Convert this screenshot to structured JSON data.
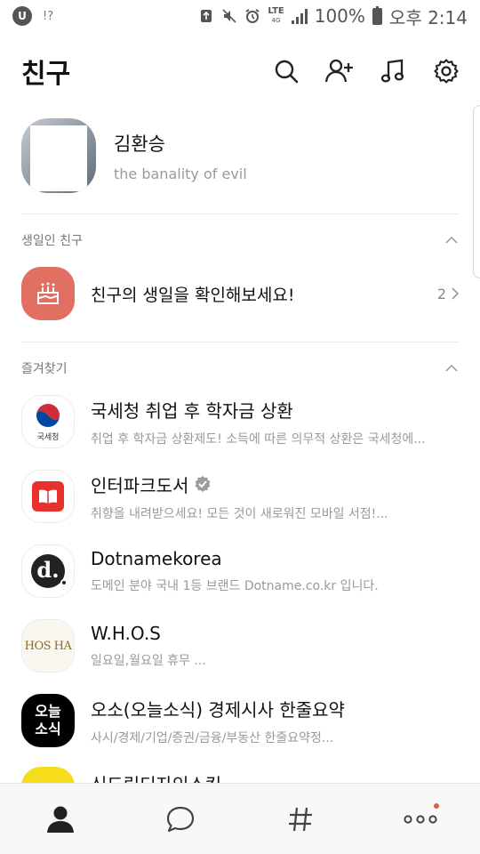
{
  "status_bar": {
    "app_badge": "U",
    "signal_text": "!?",
    "network": "LTE",
    "network_sub": "4G",
    "battery": "100%",
    "time": "오후 2:14"
  },
  "header": {
    "title": "친구",
    "icons": [
      "search-icon",
      "add-friend-icon",
      "music-icon",
      "settings-icon"
    ]
  },
  "profile": {
    "name": "김환승",
    "status": "the banality of evil"
  },
  "birthday_section": {
    "label": "생일인 친구",
    "row_text": "친구의 생일을 확인해보세요!",
    "count": "2"
  },
  "favorites_section": {
    "label": "즐겨찾기",
    "items": [
      {
        "title": "국세청 취업 후 학자금 상환",
        "subtitle": "취업 후 학자금 상환제도! 소득에 따른 의무적 상환은 국세청에...",
        "icon_label": "국세청"
      },
      {
        "title": "인터파크도서",
        "subtitle": "취향을 내려받으세요! 모든 것이 새로워진 모바일 서점!...",
        "verified": true
      },
      {
        "title": "Dotnamekorea",
        "subtitle": "도메인 분야 국내 1등 브랜드  Dotname.co.kr 입니다.",
        "icon_label": "d."
      },
      {
        "title": "W.H.O.S",
        "subtitle": "일요일,월요일 휴무      ...",
        "icon_label": "HOS HA"
      },
      {
        "title": "오소(오늘소식) 경제시사 한줄요약",
        "subtitle": "사시/경제/기업/증권/금융/부동산 한줄요약정...",
        "icon_line1": "오늘",
        "icon_line2": "소식"
      },
      {
        "title": "신드림디자인스킨"
      }
    ]
  },
  "bottom_nav": {
    "items": [
      "friends-icon",
      "chat-icon",
      "hashtag-icon",
      "more-icon"
    ],
    "colors": {
      "active": "#222222",
      "inactive": "#444444",
      "dot": "#e25d48"
    }
  },
  "colors": {
    "birthday_bg": "#e16f62",
    "interpark_red": "#e8312c",
    "yellow": "#f6dd1c"
  }
}
